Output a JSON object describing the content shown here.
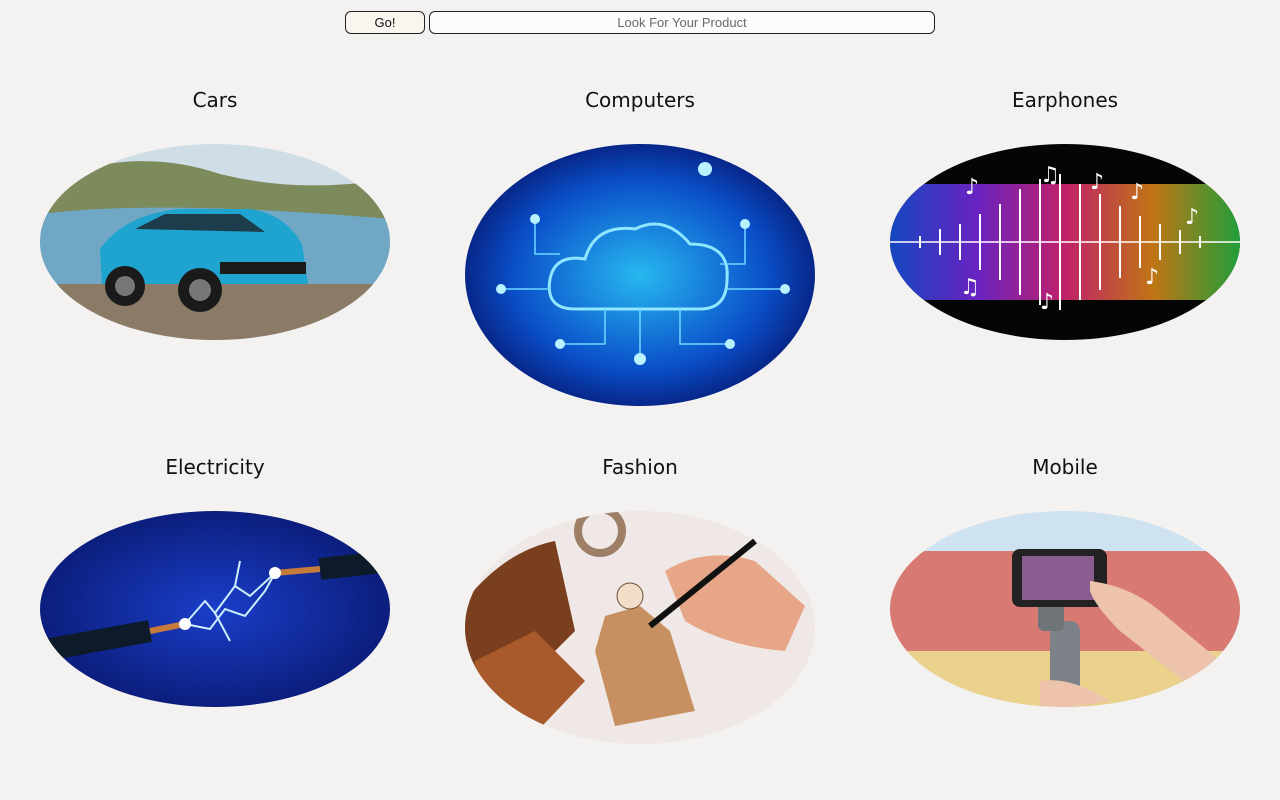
{
  "search": {
    "button_label": "Go!",
    "placeholder": "Look For Your Product"
  },
  "categories": [
    {
      "title": "Cars",
      "image_icon": "car-image"
    },
    {
      "title": "Computers",
      "image_icon": "cloud-computing-image"
    },
    {
      "title": "Earphones",
      "image_icon": "music-waveform-image"
    },
    {
      "title": "Electricity",
      "image_icon": "electric-wires-image"
    },
    {
      "title": "Fashion",
      "image_icon": "fashion-sketch-image"
    },
    {
      "title": "Mobile",
      "image_icon": "phone-gimbal-image"
    }
  ]
}
